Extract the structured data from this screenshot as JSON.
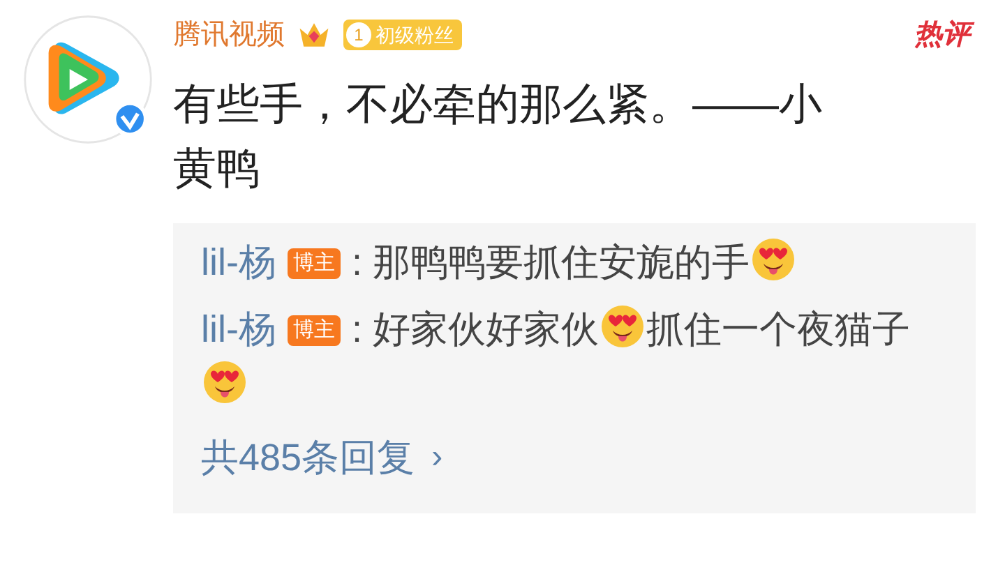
{
  "comment": {
    "author": "腾讯视频",
    "fan_badge": {
      "level": "1",
      "label": "初级粉丝"
    },
    "tag": "热评",
    "text": "有些手，不必牵的那么紧。——小黄鸭"
  },
  "replies": [
    {
      "name": "lil-杨",
      "badge": "博主",
      "separator": ":",
      "parts": [
        {
          "kind": "text",
          "text": "那鸭鸭要抓住安旎的手"
        },
        {
          "kind": "emoji"
        }
      ]
    },
    {
      "name": "lil-杨",
      "badge": "博主",
      "separator": ":",
      "parts": [
        {
          "kind": "text",
          "text": "好家伙好家伙"
        },
        {
          "kind": "emoji"
        },
        {
          "kind": "text",
          "text": "抓住一个夜猫子"
        },
        {
          "kind": "emoji"
        }
      ]
    }
  ],
  "more_replies": {
    "label": "共485条回复",
    "arrow": "›"
  }
}
